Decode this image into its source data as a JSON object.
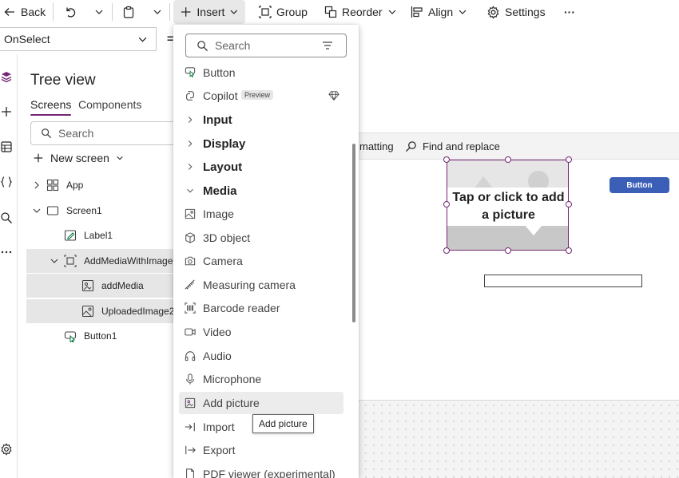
{
  "command_bar": {
    "back": "Back",
    "insert": "Insert",
    "group": "Group",
    "reorder": "Reorder",
    "align": "Align",
    "settings": "Settings",
    "more": "···"
  },
  "formula": {
    "property": "OnSelect",
    "equals": "="
  },
  "tree_view": {
    "title": "Tree view",
    "tabs": [
      "Screens",
      "Components"
    ],
    "active_tab": "Screens",
    "search_placeholder": "Search",
    "new_screen": "New screen",
    "nodes": [
      {
        "label": "App",
        "icon": "app-icon",
        "selected": false
      },
      {
        "label": "Screen1",
        "icon": "screen-icon",
        "selected": false
      },
      {
        "label": "Label1",
        "icon": "label-icon",
        "selected": false
      },
      {
        "label": "AddMediaWithImage2",
        "icon": "group-icon",
        "selected": true
      },
      {
        "label": "addMedia",
        "icon": "add-media-icon",
        "selected": true
      },
      {
        "label": "UploadedImage2",
        "icon": "image-icon",
        "selected": true
      },
      {
        "label": "Button1",
        "icon": "button-icon",
        "selected": false
      }
    ]
  },
  "canvas": {
    "toolbar_formatting": "matting",
    "find_replace": "Find and replace",
    "add_media_text": "Tap or click to add a picture",
    "button_label": "Button"
  },
  "insert_flyout": {
    "search_placeholder": "Search",
    "preview_badge": "Preview",
    "items": [
      {
        "label": "Button",
        "icon": "button-icon",
        "category": false
      },
      {
        "label": "Copilot",
        "icon": "copilot-icon",
        "category": false
      },
      {
        "label": "Input",
        "icon": "chevron-right-icon",
        "category": true
      },
      {
        "label": "Display",
        "icon": "chevron-right-icon",
        "category": true
      },
      {
        "label": "Layout",
        "icon": "chevron-right-icon",
        "category": true
      },
      {
        "label": "Media",
        "icon": "chevron-down-icon",
        "category": true
      },
      {
        "label": "Image",
        "icon": "image-icon",
        "category": false
      },
      {
        "label": "3D object",
        "icon": "cube-icon",
        "category": false
      },
      {
        "label": "Camera",
        "icon": "camera-icon",
        "category": false
      },
      {
        "label": "Measuring camera",
        "icon": "measuring-camera-icon",
        "category": false
      },
      {
        "label": "Barcode reader",
        "icon": "barcode-icon",
        "category": false
      },
      {
        "label": "Video",
        "icon": "video-icon",
        "category": false
      },
      {
        "label": "Audio",
        "icon": "headphones-icon",
        "category": false
      },
      {
        "label": "Microphone",
        "icon": "microphone-icon",
        "category": false
      },
      {
        "label": "Add picture",
        "icon": "add-picture-icon",
        "category": false
      },
      {
        "label": "Import",
        "icon": "import-icon",
        "category": false
      },
      {
        "label": "Export",
        "icon": "export-icon",
        "category": false
      },
      {
        "label": "PDF viewer (experimental)",
        "icon": "pdf-icon",
        "category": false
      }
    ],
    "hovered_item": "Add picture"
  },
  "tooltip": "Add picture",
  "colors": {
    "accent": "#742774",
    "canvas_button": "#3b5fb7"
  }
}
